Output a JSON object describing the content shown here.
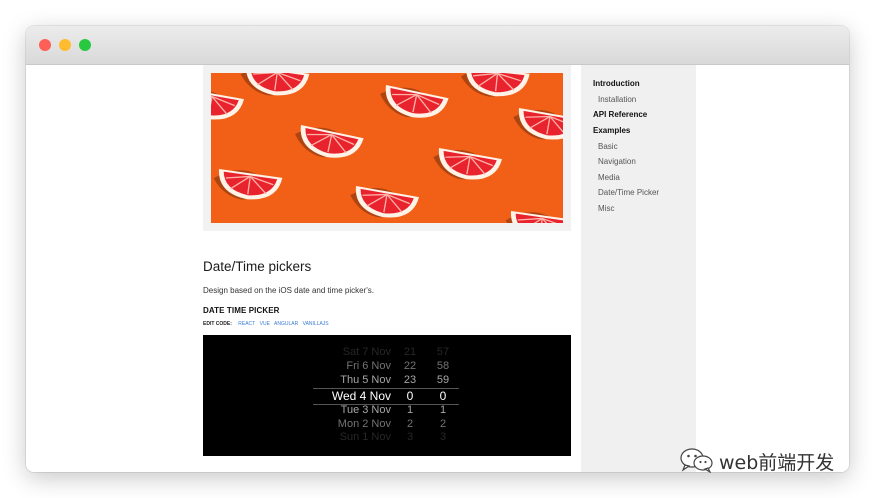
{
  "window": {
    "traffic_lights": [
      "#fe5f57",
      "#febc2e",
      "#28c840"
    ]
  },
  "hero": {
    "background_color": "#f25f17",
    "subject": "grapefruit-slices"
  },
  "main": {
    "heading": "Date/Time pickers",
    "description": "Design based on the iOS date and time picker's.",
    "subheading": "DATE TIME PICKER",
    "edit_code_label": "EDIT CODE:",
    "edit_links": [
      "REACT",
      "VUE",
      "ANGULAR",
      "VANILLAJS"
    ]
  },
  "picker": {
    "rows": [
      {
        "date": "Sat 7 Nov",
        "hour": "21",
        "minute": "57"
      },
      {
        "date": "Fri 6 Nov",
        "hour": "22",
        "minute": "58"
      },
      {
        "date": "Thu 5 Nov",
        "hour": "23",
        "minute": "59"
      },
      {
        "date": "Wed 4 Nov",
        "hour": "0",
        "minute": "0",
        "selected": true
      },
      {
        "date": "Tue 3 Nov",
        "hour": "1",
        "minute": "1"
      },
      {
        "date": "Mon 2 Nov",
        "hour": "2",
        "minute": "2"
      },
      {
        "date": "Sun 1 Nov",
        "hour": "3",
        "minute": "3"
      }
    ]
  },
  "sidebar": {
    "items": [
      {
        "label": "Introduction",
        "level": "top"
      },
      {
        "label": "Installation",
        "level": "sub"
      },
      {
        "label": "API Reference",
        "level": "top"
      },
      {
        "label": "Examples",
        "level": "top"
      },
      {
        "label": "Basic",
        "level": "sub"
      },
      {
        "label": "Navigation",
        "level": "sub"
      },
      {
        "label": "Media",
        "level": "sub"
      },
      {
        "label": "Date/Time Picker",
        "level": "sub"
      },
      {
        "label": "Misc",
        "level": "sub"
      }
    ]
  },
  "watermark": {
    "text": "web前端开发",
    "icon": "wechat-icon"
  }
}
